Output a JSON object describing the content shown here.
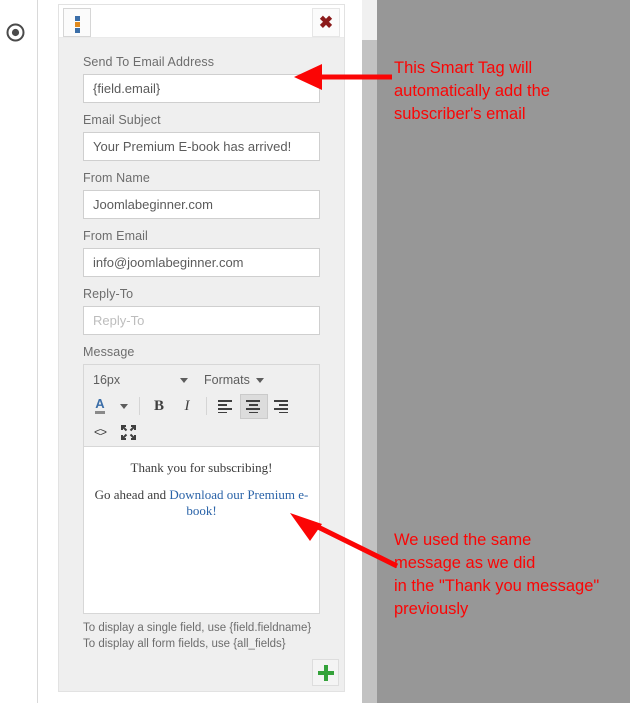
{
  "rail": {
    "radio_icon": "target-circle-icon"
  },
  "panel": {
    "header": {
      "drag_handle_icon": "drag-dots-icon",
      "close_icon": "✖"
    },
    "fields": [
      {
        "label": "Send To Email Address",
        "value": "{field.email}",
        "placeholder": "",
        "name": "send-to-email"
      },
      {
        "label": "Email Subject",
        "value": "Your Premium E-book has arrived!",
        "placeholder": "",
        "name": "email-subject"
      },
      {
        "label": "From Name",
        "value": "Joomlabeginner.com",
        "placeholder": "",
        "name": "from-name"
      },
      {
        "label": "From Email",
        "value": "info@joomlabeginner.com",
        "placeholder": "",
        "name": "from-email"
      },
      {
        "label": "Reply-To",
        "value": "",
        "placeholder": "Reply-To",
        "name": "reply-to"
      }
    ],
    "message": {
      "label": "Message",
      "toolbar": {
        "fontsize": "16px",
        "formats": "Formats",
        "textcolor_glyph": "A",
        "bold": "B",
        "italic": "I",
        "align_left_icon": "align-left-icon",
        "align_center_icon": "align-center-icon",
        "align_right_icon": "align-right-icon",
        "source_code": "<>",
        "fullscreen_icon": "fullscreen-icon"
      },
      "body": {
        "line1": "Thank you for subscribing!",
        "line2_prefix": "Go ahead and ",
        "link_text": "Download our Premium e-book!"
      }
    },
    "hints": {
      "line1": "To display a single field, use {field.fieldname}",
      "line2": "To display all form fields, use {all_fields}"
    },
    "add_button_icon": "plus-icon"
  },
  "annotations": {
    "top": "This Smart Tag will\nautomatically add the\nsubscriber's email",
    "bottom": "We used the same\nmessage as we did\nin the \"Thank you message\"\npreviously",
    "color": "#fb0505"
  }
}
